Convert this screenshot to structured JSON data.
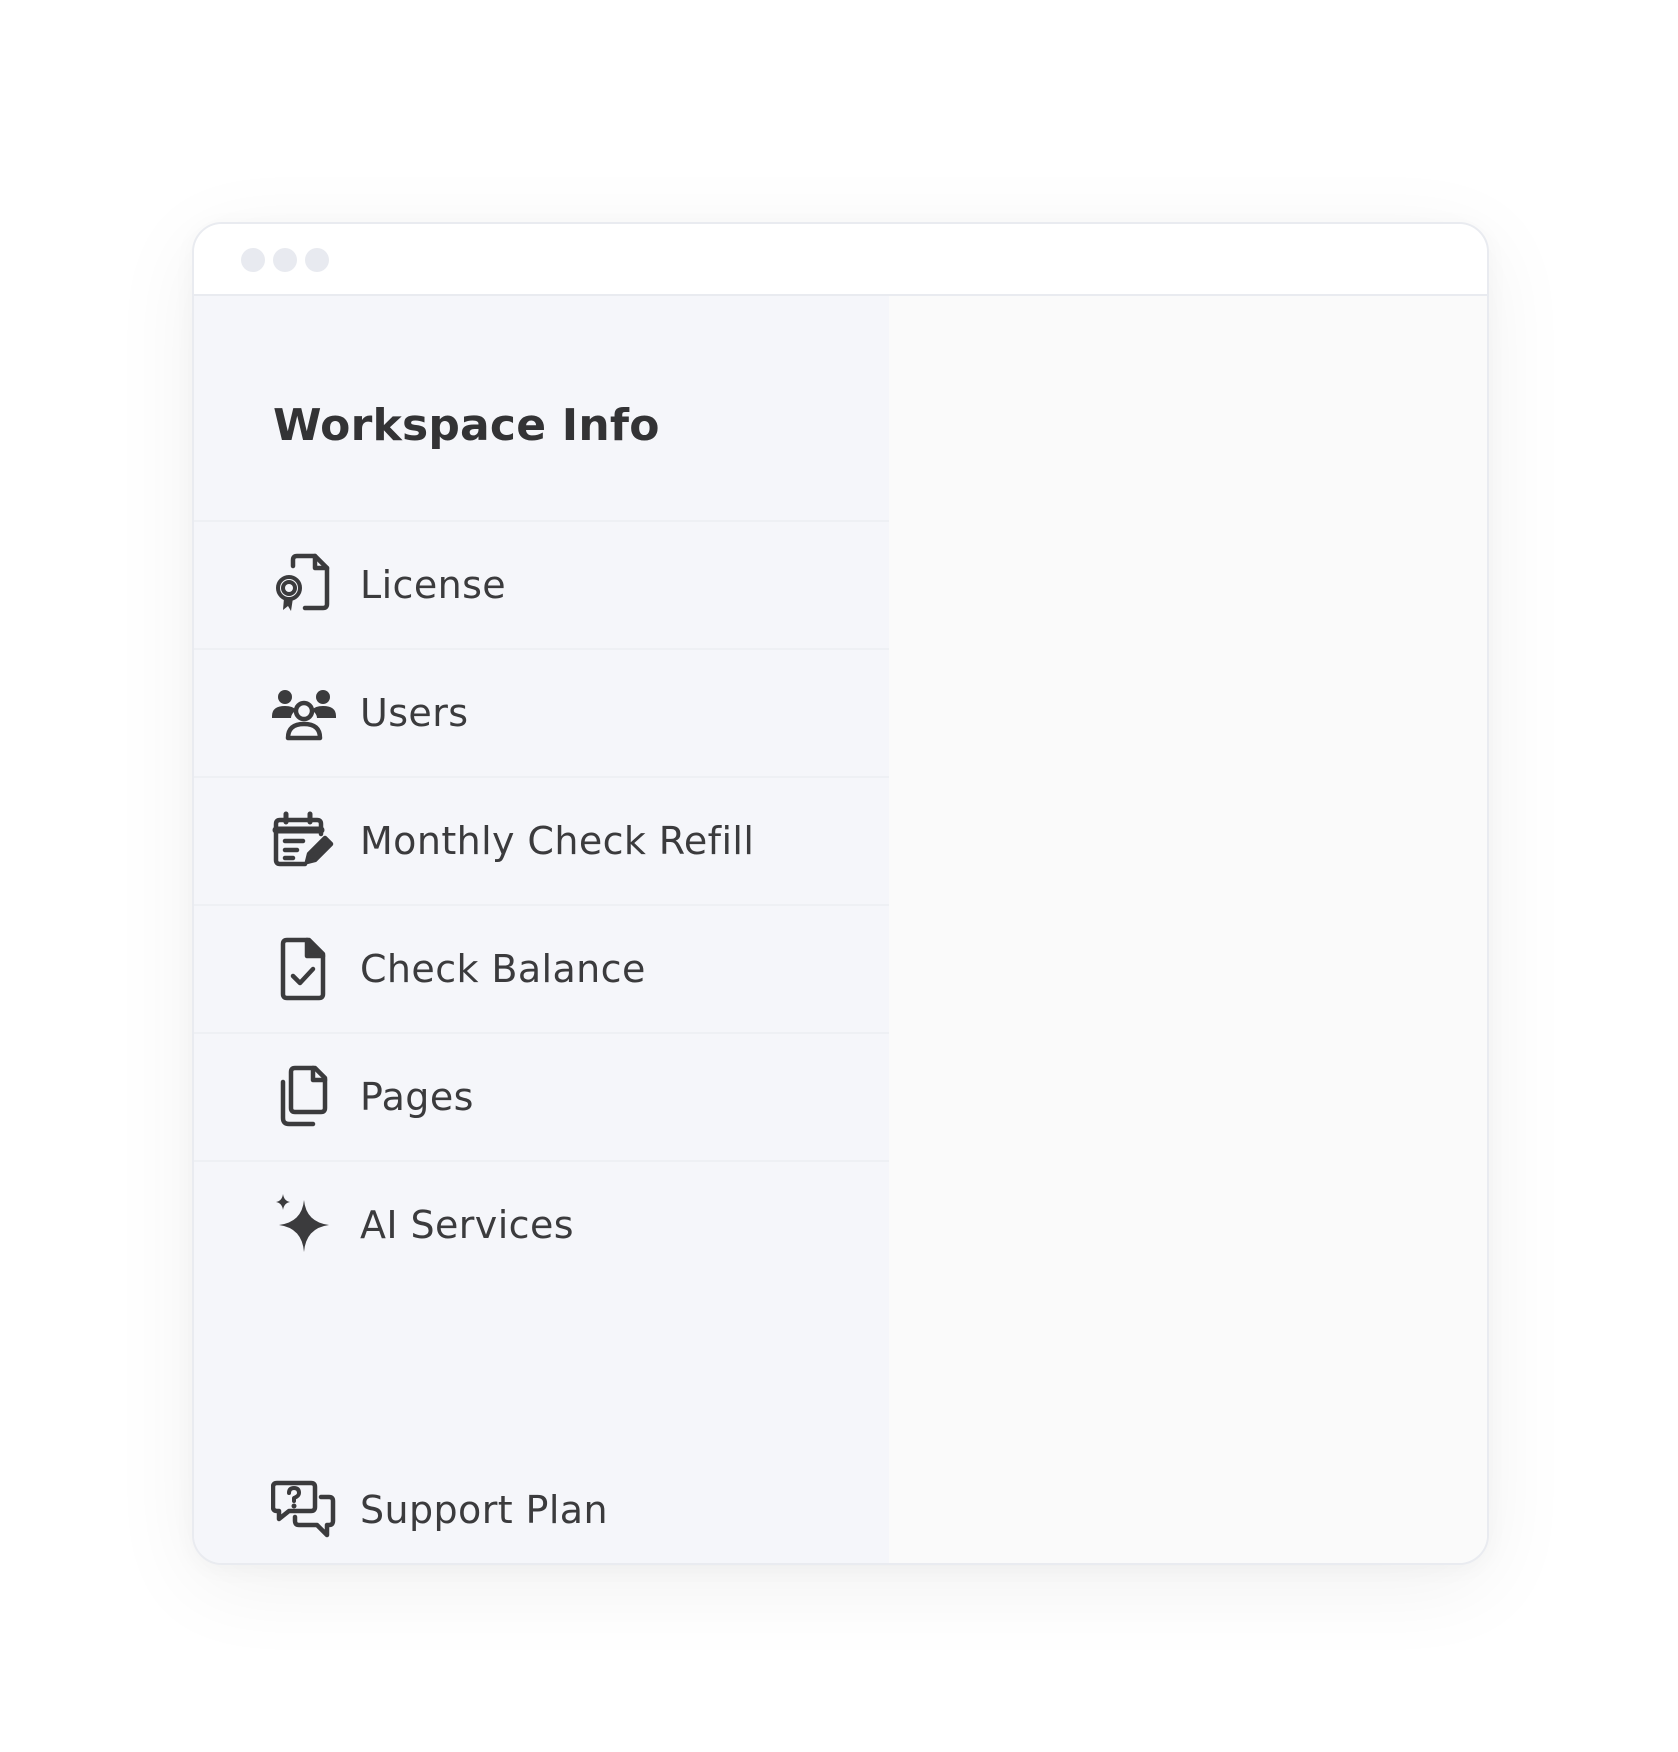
{
  "sidebar": {
    "title": "Workspace Info",
    "items": [
      {
        "label": "License",
        "icon": "license-icon"
      },
      {
        "label": "Users",
        "icon": "users-icon"
      },
      {
        "label": "Monthly Check Refill",
        "icon": "calendar-edit-icon"
      },
      {
        "label": "Check Balance",
        "icon": "document-check-icon"
      },
      {
        "label": "Pages",
        "icon": "pages-icon"
      },
      {
        "label": "AI Services",
        "icon": "sparkle-icon"
      }
    ],
    "footer_item": {
      "label": "Support Plan",
      "icon": "support-chat-icon"
    }
  },
  "colors": {
    "sidebar_bg": "#f5f6fa",
    "content_bg": "#fafafa",
    "text": "#3b3b3d",
    "window_dots": "#e8eaf0"
  }
}
